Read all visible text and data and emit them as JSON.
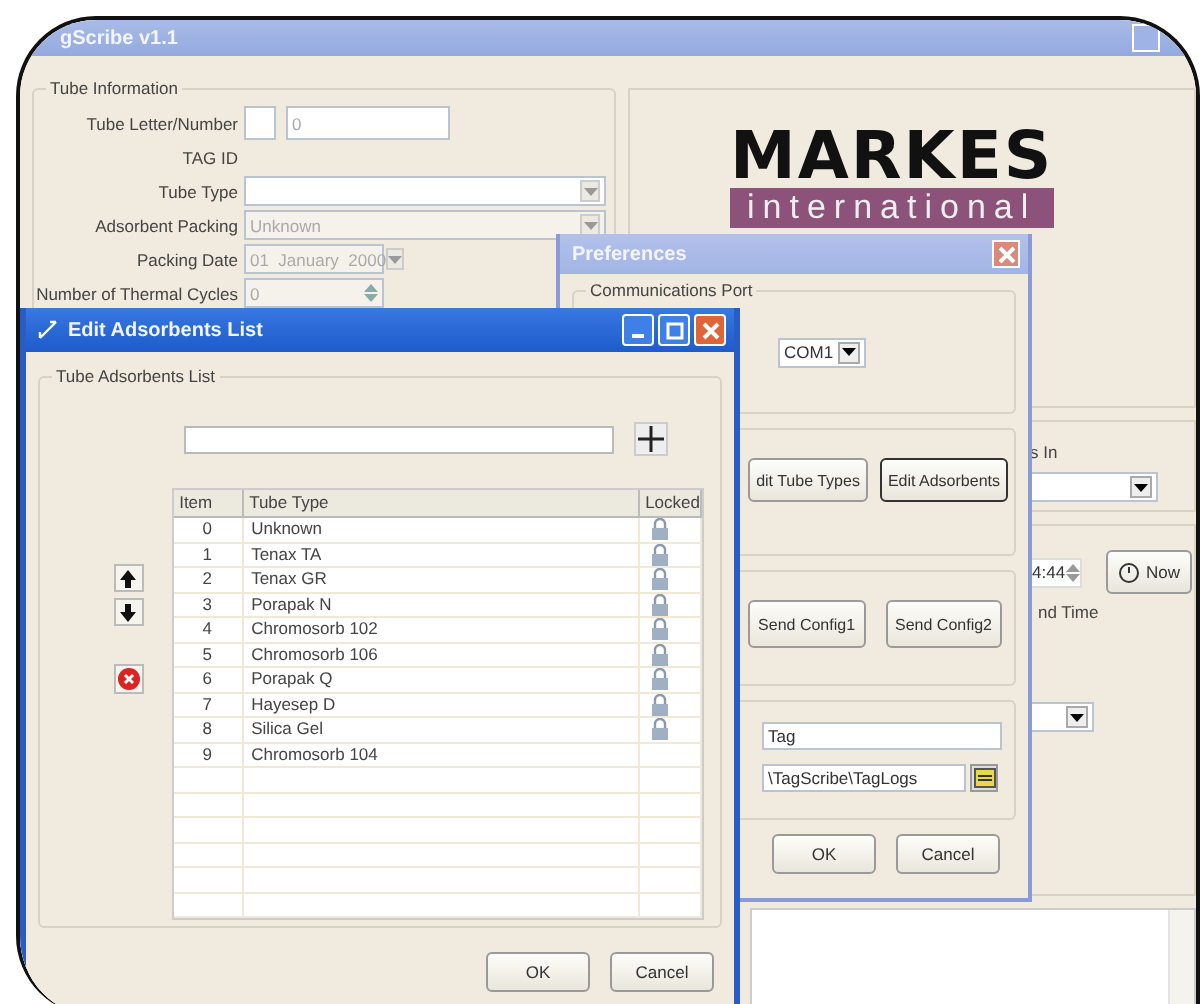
{
  "main_window": {
    "title": "gScribe v1.1",
    "tube_information": {
      "title": "Tube Information",
      "fields": [
        {
          "label": "Tube Letter/Number",
          "kind": "pair",
          "value": "0"
        },
        {
          "label": "TAG ID",
          "kind": "label"
        },
        {
          "label": "Tube Type",
          "kind": "dropdown",
          "disabled": false
        },
        {
          "label": "Adsorbent Packing",
          "kind": "dropdown",
          "value": "Unknown",
          "disabled": true
        },
        {
          "label": "Packing Date",
          "kind": "date",
          "value": "01  January  2000",
          "disabled": true
        },
        {
          "label": "Number of Thermal Cycles",
          "kind": "spinner",
          "value": "0",
          "disabled": true
        }
      ]
    },
    "logo": {
      "name": "MARKES",
      "subtitle": "international"
    },
    "partial_label": "s In",
    "clock": {
      "time": "4:44",
      "now_button": "Now",
      "caption": "nd Time"
    }
  },
  "preferences": {
    "title": "Preferences",
    "port_group": "Communications Port",
    "port": "COM1",
    "edit_buttons": [
      {
        "label": "dit Tube Types",
        "focused": false
      },
      {
        "label": "Edit Adsorbents",
        "focused": true
      }
    ],
    "send_buttons": [
      "Send Config1",
      "Send Config2"
    ],
    "name_field": "Tag",
    "path_field": "\\TagScribe\\TagLogs",
    "buttons": [
      "OK",
      "Cancel"
    ]
  },
  "edit_adsorbents": {
    "title": "Edit Adsorbents List",
    "group": "Tube Adsorbents List",
    "columns": [
      "Item",
      "Tube Type",
      "Locked"
    ],
    "rows": [
      {
        "item": "0",
        "type": "Unknown",
        "locked": true
      },
      {
        "item": "1",
        "type": "Tenax TA",
        "locked": true
      },
      {
        "item": "2",
        "type": "Tenax GR",
        "locked": true
      },
      {
        "item": "3",
        "type": "Porapak N",
        "locked": true
      },
      {
        "item": "4",
        "type": "Chromosorb 102",
        "locked": true
      },
      {
        "item": "5",
        "type": "Chromosorb 106",
        "locked": true
      },
      {
        "item": "6",
        "type": "Porapak Q",
        "locked": true
      },
      {
        "item": "7",
        "type": "Hayesep D",
        "locked": true
      },
      {
        "item": "8",
        "type": "Silica Gel",
        "locked": true
      },
      {
        "item": "9",
        "type": "Chromosorb 104",
        "locked": false
      }
    ],
    "buttons": [
      "OK",
      "Cancel"
    ]
  }
}
